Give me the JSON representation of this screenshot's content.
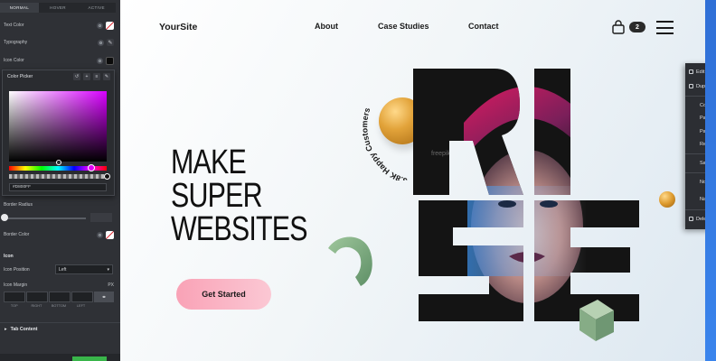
{
  "panel": {
    "state_tabs": [
      "NORMAL",
      "HOVER",
      "ACTIVE"
    ],
    "active_state_tab": "NORMAL",
    "rows": {
      "text_color": "Text Color",
      "typography": "Typography",
      "icon_color": "Icon Color",
      "border_radius": "Border Radius",
      "border_color": "Border Color"
    },
    "color_picker": {
      "title": "Color Picker",
      "hex_value": "#D800FF",
      "hue_color": "#e000f5"
    },
    "icon_section": {
      "title": "Icon",
      "position_label": "Icon Position",
      "position_value": "Left",
      "margin_label": "Icon Margin",
      "margin_unit": "PX",
      "margin_sides": [
        "TOP",
        "RIGHT",
        "BOTTOM",
        "LEFT"
      ]
    },
    "tab_content": "Tab Content"
  },
  "site": {
    "logo": "YourSite",
    "nav": [
      "About",
      "Case Studies",
      "Contact"
    ],
    "cart_count": "2",
    "hero_lines": [
      "MAKE",
      "SUPER",
      "WEBSITES"
    ],
    "cta": "Get Started",
    "curved_text": "3.8K Happy Customers",
    "art_word": "RISE",
    "watermark": "freepik"
  },
  "context_menu": {
    "items": [
      "Edit He",
      "Duplica",
      "Copy",
      "Paste",
      "Paste S",
      "Reset S",
      "Save a",
      "Notes",
      "Navig",
      "Delete"
    ]
  },
  "colors": {
    "cta_gradient_start": "#f9a2b6",
    "accent_gold": "#e2a33a",
    "cube_green": "#8fb38f"
  }
}
